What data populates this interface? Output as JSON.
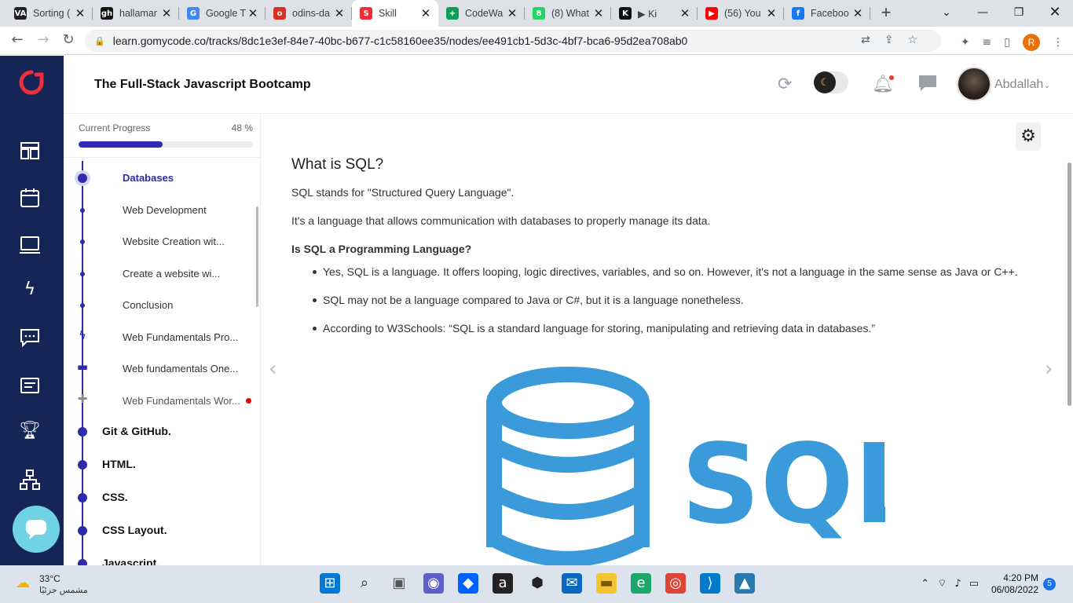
{
  "browser": {
    "tabs": [
      {
        "title": "Sorting (",
        "favicon": "VA",
        "color": "#222"
      },
      {
        "title": "hallamar",
        "favicon": "gh",
        "color": "#111"
      },
      {
        "title": "Google T",
        "favicon": "G",
        "color": "#4285f4"
      },
      {
        "title": "odins-da",
        "favicon": "o",
        "color": "#d93025"
      },
      {
        "title": "Skill",
        "favicon": "S",
        "color": "#ef2d3b"
      },
      {
        "title": "CodeWa",
        "favicon": "+",
        "color": "#0f9d58"
      },
      {
        "title": "(8) What",
        "favicon": "8",
        "color": "#25d366"
      },
      {
        "title": "▶ Ki",
        "favicon": "K",
        "color": "#111"
      },
      {
        "title": "(56) You",
        "favicon": "▶",
        "color": "#ff0000"
      },
      {
        "title": "Faceboo",
        "favicon": "f",
        "color": "#1877f2"
      }
    ],
    "url": "learn.gomycode.co/tracks/8dc1e3ef-84e7-40bc-b677-c1c58160ee35/nodes/ee491cb1-5d3c-4bf7-bca6-95d2ea708ab0",
    "profile_initial": "R"
  },
  "header": {
    "course_title": "The Full-Stack Javascript Bootcamp",
    "username": "Abdallah"
  },
  "progress": {
    "label": "Current Progress",
    "percent_label": "48 %",
    "percent": 0.48
  },
  "sidebar": {
    "items": [
      {
        "label": "Databases",
        "kind": "active"
      },
      {
        "label": "Web Development",
        "kind": "dot"
      },
      {
        "label": "Website Creation wit...",
        "kind": "dot"
      },
      {
        "label": "Create a website wi...",
        "kind": "dot"
      },
      {
        "label": "Conclusion",
        "kind": "dot"
      },
      {
        "label": "Web Fundamentals Pro...",
        "kind": "bolt"
      },
      {
        "label": "Web fundamentals One...",
        "kind": "chat"
      },
      {
        "label": "Web Fundamentals Wor...",
        "kind": "puzzle"
      }
    ],
    "sections": [
      "Git & GitHub.",
      "HTML.",
      "CSS.",
      "CSS Layout.",
      "Javascript."
    ]
  },
  "content": {
    "heading": "What is SQL?",
    "p1": "SQL stands for \"Structured Query Language\".",
    "p2": "It's a language that allows communication with databases to properly manage its data.",
    "subheading": "Is SQL a Programming Language?",
    "bullets": [
      "Yes, SQL is a language. It offers looping, logic directives, variables, and so on. However, it's not a language in the same sense as Java or C++.",
      "SQL may not be a language compared to Java or C#, but it is a language nonetheless.",
      "According to W3Schools: “SQL is a standard language for storing, manipulating and retrieving data in databases.”"
    ],
    "image_text": "SQL",
    "brand_color": "#3b9ad9"
  },
  "taskbar": {
    "temperature": "33°C",
    "weather_desc": "مشمس جزئيًا",
    "time": "4:20 PM",
    "date": "06/08/2022",
    "notifications": "5"
  },
  "colors": {
    "accent": "#2f2aa8",
    "nav_bg": "#142556",
    "logo": "#ef2d3b"
  }
}
